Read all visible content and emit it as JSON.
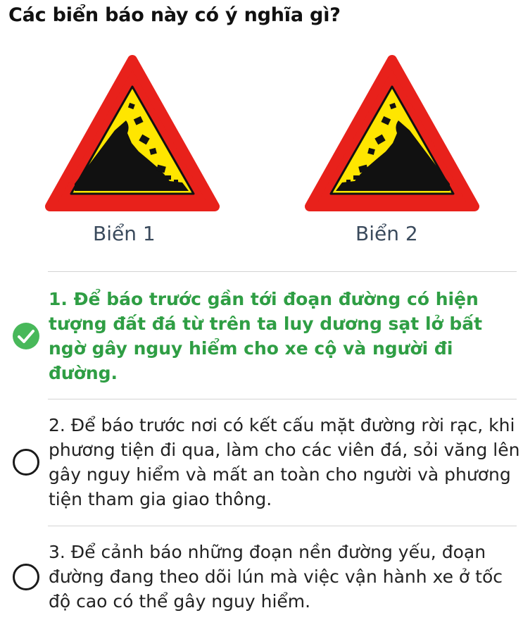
{
  "question": "Các biển báo này có ý nghĩa gì?",
  "signs": [
    {
      "caption": "Biển 1",
      "icon": "falling-rocks-left-warning-sign"
    },
    {
      "caption": "Biển 2",
      "icon": "falling-rocks-right-warning-sign"
    }
  ],
  "answers": [
    {
      "text": "1. Để báo trước gần tới đoạn đường có hiện tượng đất đá từ trên ta luy dương sạt lở bất ngờ gây nguy hiểm cho xe cộ và người đi đường.",
      "selected": true
    },
    {
      "text": "2. Để báo trước nơi có kết cấu mặt đường rời rạc, khi phương tiện đi qua, làm cho các viên đá, sỏi văng lên gây nguy hiểm và mất an toàn cho người và phương tiện tham gia giao thông.",
      "selected": false
    },
    {
      "text": "3. Để cảnh báo những đoạn nền đường yếu, đoạn đường đang theo dõi lún mà việc vận hành xe ở tốc độ cao có thể gây nguy hiểm.",
      "selected": false
    }
  ],
  "colors": {
    "correct": "#2f9e44",
    "check": "#48b85a",
    "sign_border": "#e8211b",
    "sign_fill": "#ffe600"
  }
}
